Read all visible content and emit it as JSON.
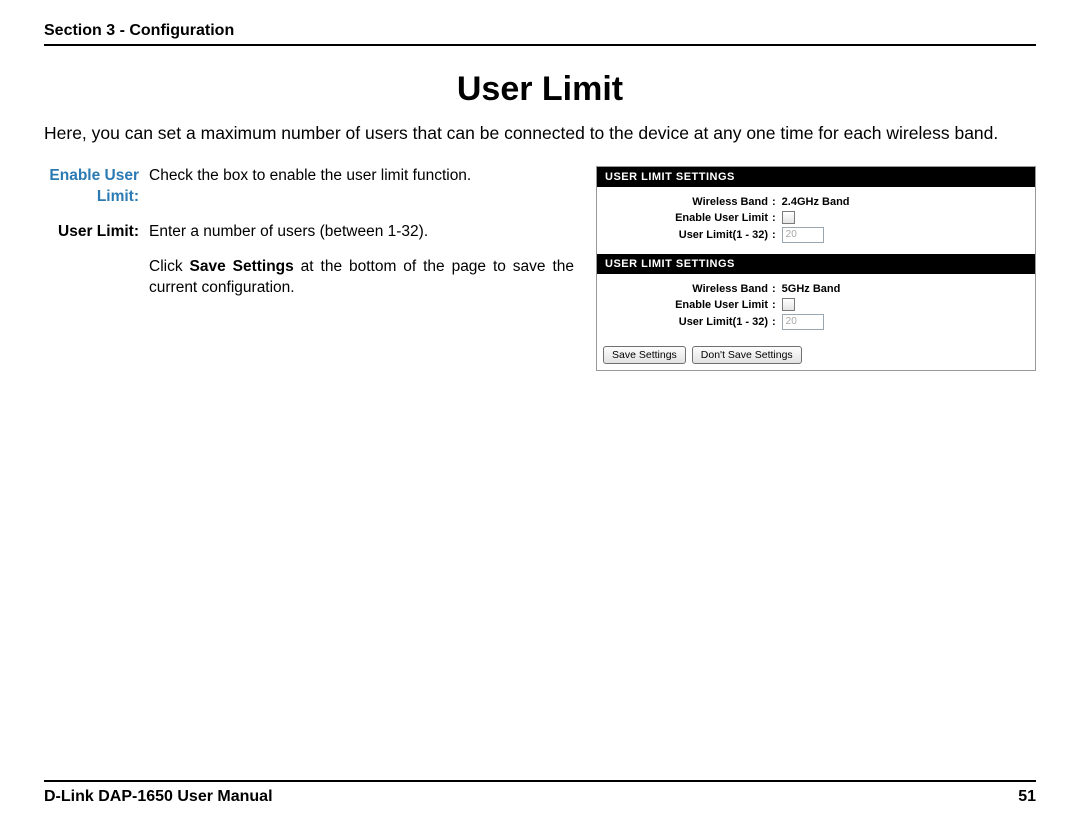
{
  "header": {
    "section": "Section 3 - Configuration"
  },
  "title": "User Limit",
  "intro": "Here, you can set a maximum number of users that can be connected to the device at any one time for each wireless band.",
  "definitions": {
    "enable_user_limit": {
      "term": "Enable User Limit:",
      "desc": "Check the box to enable the user limit function."
    },
    "user_limit": {
      "term": "User Limit:",
      "desc": "Enter a number of users (between 1-32)."
    },
    "save_note_pre": "Click ",
    "save_note_bold": "Save Settings",
    "save_note_post": " at the bottom of the page to save the current configuration."
  },
  "screenshot": {
    "panel_title": "USER LIMIT SETTINGS",
    "rows": {
      "wireless_band_label": "Wireless Band",
      "enable_label": "Enable User Limit",
      "limit_label": "User Limit(1 - 32)"
    },
    "band24": {
      "band_value": "2.4GHz Band",
      "limit_value": "20"
    },
    "band5": {
      "band_value": "5GHz Band",
      "limit_value": "20"
    },
    "buttons": {
      "save": "Save Settings",
      "dont": "Don't Save Settings"
    },
    "colon": ":"
  },
  "footer": {
    "manual": "D-Link DAP-1650 User Manual",
    "page": "51"
  }
}
